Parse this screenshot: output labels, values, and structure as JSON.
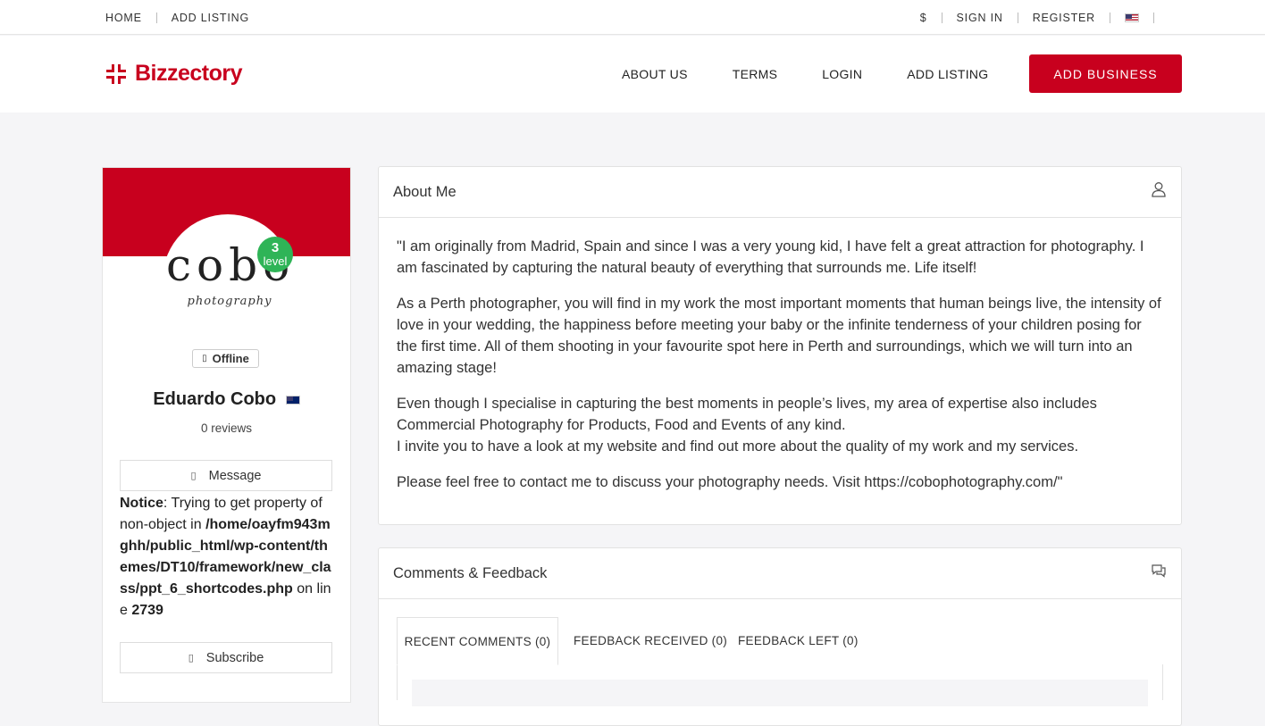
{
  "topbar": {
    "left": [
      "HOME",
      "ADD LISTING"
    ],
    "currency": "$",
    "sign_in": "SIGN IN",
    "register": "REGISTER",
    "flag_icon": "us-flag-icon"
  },
  "header": {
    "logo_text": "Bizzectory",
    "nav": [
      "ABOUT US",
      "TERMS",
      "LOGIN",
      "ADD LISTING"
    ],
    "cta": "ADD BUSINESS",
    "brand_color": "#c8001e"
  },
  "profile": {
    "avatar_text": "cobo",
    "avatar_subtext": "photography",
    "level_number": "3",
    "level_label": "level",
    "status": "Offline",
    "name": "Eduardo Cobo",
    "country_flag": "au-flag-icon",
    "reviews": "0 reviews",
    "message_label": "Message",
    "notice_label": "Notice",
    "notice_text": ": Trying to get property of non-object in ",
    "notice_path": "/home/oayfm943mghh/public_html/wp-content/themes/DT10/framework/new_class/ppt_6_shortcodes.php",
    "notice_on_line": " on line ",
    "notice_line": "2739",
    "subscribe_label": "Subscribe"
  },
  "about": {
    "title": "About Me",
    "icon": "user-icon",
    "paragraphs": [
      "\"I am originally from Madrid, Spain and since I was a very young kid, I have felt a great attraction for photography. I am fascinated by capturing the natural beauty of everything that surrounds me. Life itself!",
      "As a Perth photographer, you will find in my work the most important moments that human beings live, the intensity of love in your wedding, the happiness before meeting your baby or the infinite tenderness of your children posing for the first time. All of them shooting in your favourite spot here in Perth and surroundings, which we will turn into an amazing stage!",
      "Even though I specialise in capturing the best moments in people’s lives, my area of expertise also includes Commercial Photography for Products, Food and Events of any kind.",
      "I invite you to have a look at my website and find out more about the quality of my work and my services.",
      "Please feel free to contact me to discuss your photography needs. Visit https://cobophotography.com/\""
    ]
  },
  "comments": {
    "title": "Comments & Feedback",
    "icon": "comments-icon",
    "tabs": [
      "RECENT COMMENTS (0)",
      "FEEDBACK RECEIVED (0)",
      "FEEDBACK LEFT (0)"
    ]
  }
}
